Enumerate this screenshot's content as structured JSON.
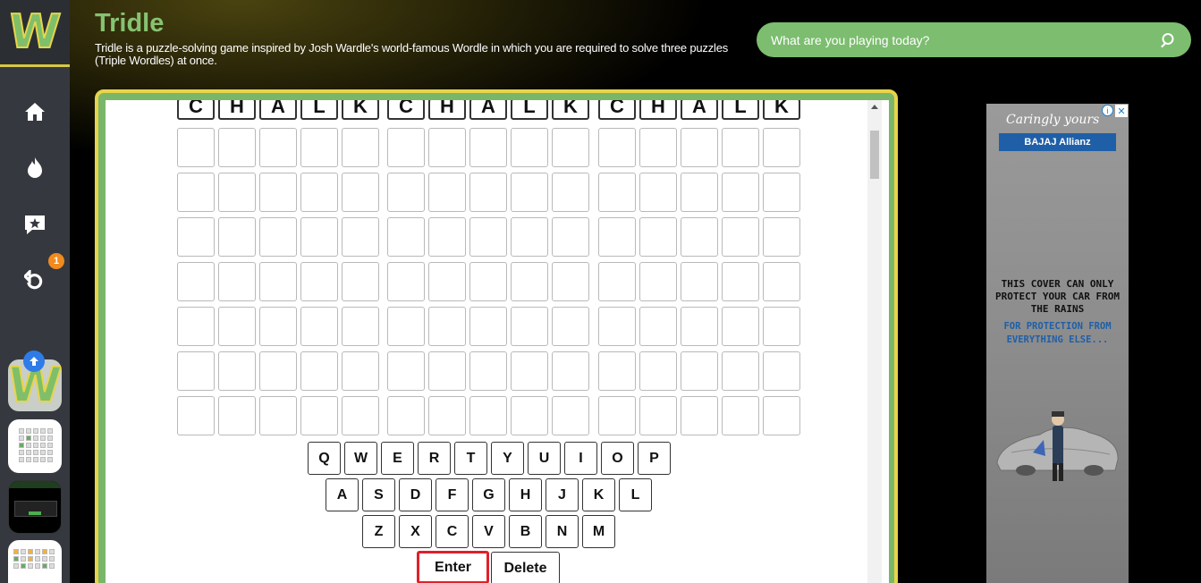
{
  "app": {
    "title": "Tridle",
    "description": "Tridle is a puzzle-solving game inspired by Josh Wardle's world-famous Wordle in which you are required to solve three puzzles (Triple Wordles) at once.",
    "logo_letter": "W"
  },
  "search": {
    "placeholder": "What are you playing today?"
  },
  "sidebar": {
    "items": [
      {
        "icon": "home-icon"
      },
      {
        "icon": "fire-icon"
      },
      {
        "icon": "star-message-icon"
      },
      {
        "icon": "undo-icon",
        "badge": "1"
      }
    ],
    "thumbnails": [
      {
        "name": "wordle-logo",
        "letter": "W"
      },
      {
        "name": "wordle-thumb"
      },
      {
        "name": "dark-game-thumb"
      },
      {
        "name": "tridle-thumb"
      }
    ]
  },
  "board": {
    "first_row": [
      "C",
      "H",
      "A",
      "L",
      "K",
      "C",
      "H",
      "A",
      "L",
      "K",
      "C",
      "H",
      "A",
      "L",
      "K"
    ],
    "empty_rows": 7
  },
  "keyboard": {
    "row1": [
      "Q",
      "W",
      "E",
      "R",
      "T",
      "Y",
      "U",
      "I",
      "O",
      "P"
    ],
    "row2": [
      "A",
      "S",
      "D",
      "F",
      "G",
      "H",
      "J",
      "K",
      "L"
    ],
    "row3": [
      "Z",
      "X",
      "C",
      "V",
      "B",
      "N",
      "M"
    ],
    "enter_label": "Enter",
    "delete_label": "Delete"
  },
  "ad": {
    "tagline": "Caringly yours",
    "brand": "BAJAJ Allianz",
    "headline": "THIS COVER CAN ONLY PROTECT YOUR CAR FROM THE RAINS",
    "subline": "FOR PROTECTION FROM EVERYTHING ELSE...",
    "info_symbol": "i",
    "close_symbol": "✕"
  },
  "colors": {
    "accent_green": "#7cbd6f",
    "accent_yellow": "#e8d44a",
    "badge_orange": "#f28a1e",
    "enter_highlight": "#e0202a"
  }
}
